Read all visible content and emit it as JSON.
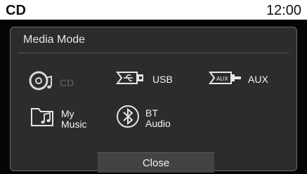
{
  "status_bar": {
    "source": "CD",
    "time": "12:00"
  },
  "dialog": {
    "title": "Media Mode",
    "options": {
      "cd": {
        "label": "CD",
        "icon": "cd-disc-icon",
        "enabled": false
      },
      "usb": {
        "label": "USB",
        "icon": "usb-icon",
        "enabled": true
      },
      "aux": {
        "label": "AUX",
        "icon": "aux-plug-icon",
        "enabled": true
      },
      "my_music": {
        "label_line1": "My",
        "label_line2": "Music",
        "icon": "music-folder-icon",
        "enabled": true
      },
      "bt_audio": {
        "label_line1": "BT",
        "label_line2": "Audio",
        "icon": "bluetooth-icon",
        "enabled": true
      }
    },
    "close_label": "Close"
  },
  "colors": {
    "status_bar_bg": "#ffffff",
    "panel_bg": "#2c2c2c",
    "dim_text": "#666666"
  }
}
